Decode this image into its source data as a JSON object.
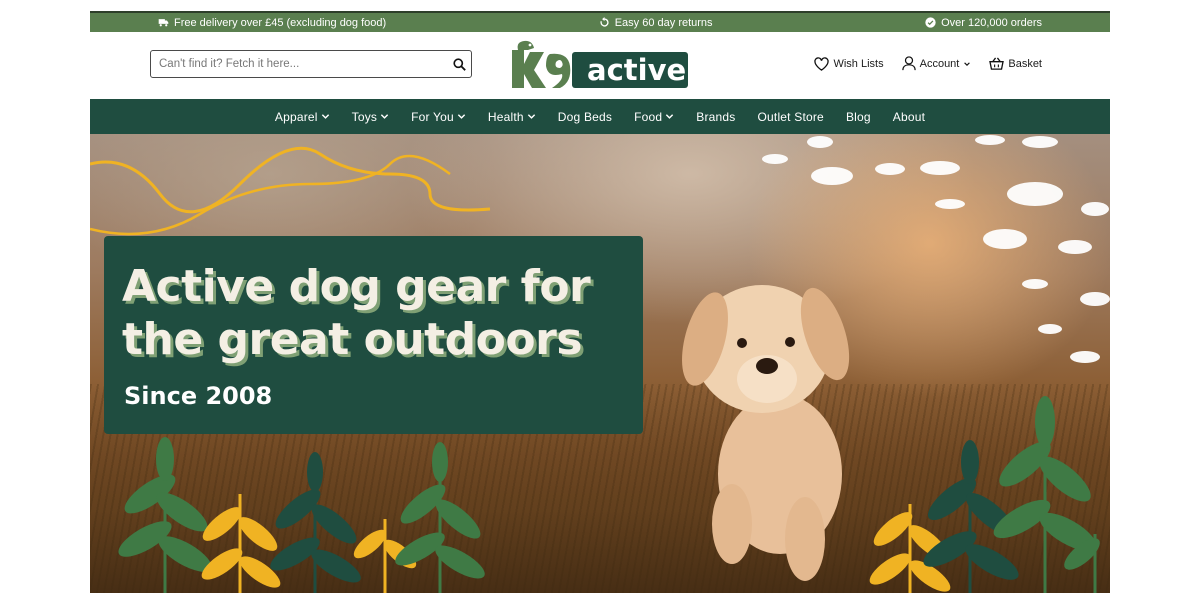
{
  "topbar": {
    "delivery": "Free delivery over £45 (excluding dog food)",
    "returns": "Easy 60 day returns",
    "orders": "Over 120,000 orders"
  },
  "header": {
    "search_placeholder": "Can't find it? Fetch it here...",
    "logo_text": "K9",
    "logo_word": "active",
    "wishlist": "Wish Lists",
    "account": "Account",
    "basket": "Basket"
  },
  "nav": {
    "items": [
      {
        "label": "Apparel"
      },
      {
        "label": "Toys"
      },
      {
        "label": "For You"
      },
      {
        "label": "Health"
      },
      {
        "label": "Dog Beds"
      },
      {
        "label": "Food"
      },
      {
        "label": "Brands"
      },
      {
        "label": "Outlet Store"
      },
      {
        "label": "Blog"
      },
      {
        "label": "About"
      }
    ]
  },
  "hero": {
    "title_line1": "Active dog gear for",
    "title_line2": "the great outdoors",
    "subtitle": "Since 2008"
  },
  "colors": {
    "brand_green": "#1f4d40",
    "topbar_green": "#5a7f4f",
    "accent_yellow": "#f0b323"
  }
}
